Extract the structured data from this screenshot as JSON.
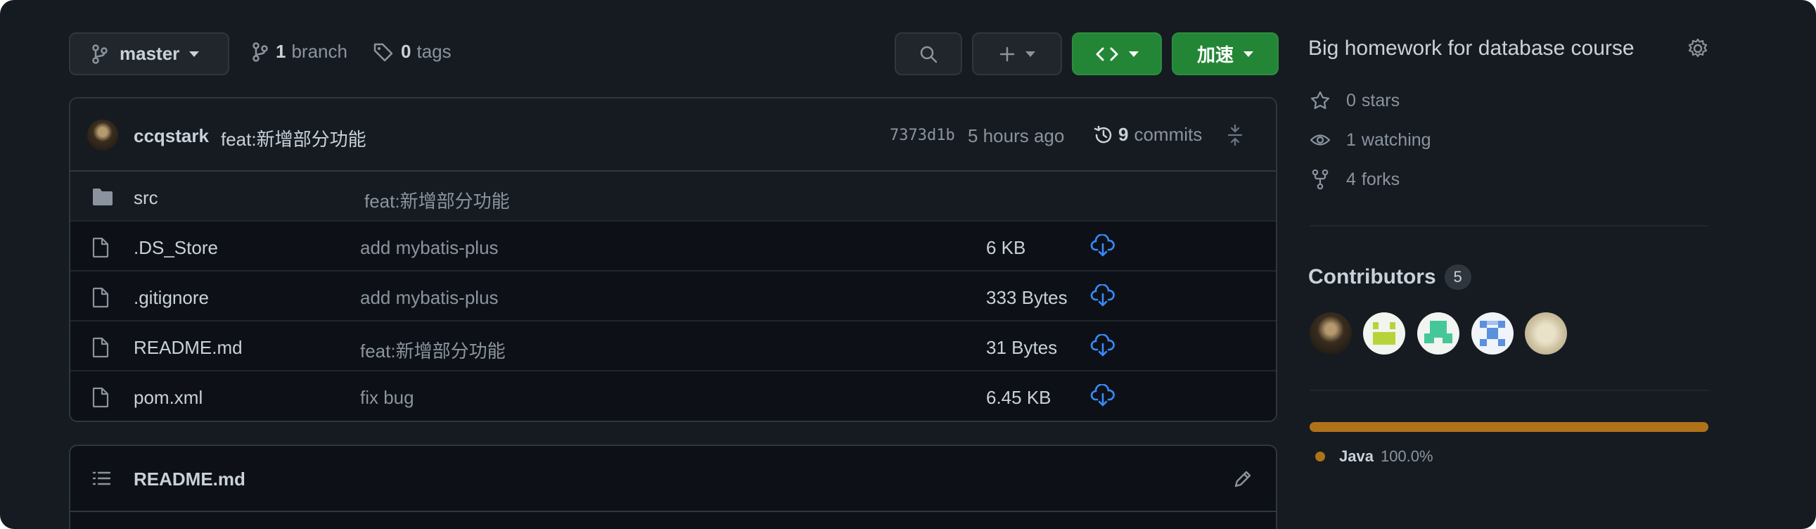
{
  "toolbar": {
    "branch_label": "master",
    "branch_count": "1",
    "branch_word": "branch",
    "tag_count": "0",
    "tag_word": "tags",
    "accelerate_label": "加速"
  },
  "latest_commit": {
    "author": "ccqstark",
    "message": "feat:新增部分功能",
    "sha": "7373d1b",
    "time": "5 hours ago",
    "commit_count": "9",
    "commit_word": "commits"
  },
  "files": [
    {
      "name": "src",
      "type": "folder",
      "message": "feat:新增部分功能",
      "size": ""
    },
    {
      "name": ".DS_Store",
      "type": "file",
      "message": "add mybatis-plus",
      "size": "6 KB"
    },
    {
      "name": ".gitignore",
      "type": "file",
      "message": "add mybatis-plus",
      "size": "333 Bytes"
    },
    {
      "name": "README.md",
      "type": "file",
      "message": "feat:新增部分功能",
      "size": "31 Bytes"
    },
    {
      "name": "pom.xml",
      "type": "file",
      "message": "fix bug",
      "size": "6.45 KB"
    }
  ],
  "readme": {
    "title": "README.md"
  },
  "sidebar": {
    "about": "Big homework for database course",
    "stars_count": "0",
    "stars_word": "stars",
    "watching_count": "1",
    "watching_word": "watching",
    "forks_count": "4",
    "forks_word": "forks",
    "contributors_title": "Contributors",
    "contributors_count": "5",
    "language_name": "Java",
    "language_percent": "100.0%"
  },
  "colors": {
    "accent_green": "#238636",
    "java": "#b07219",
    "download_icon": "#388bfd"
  }
}
